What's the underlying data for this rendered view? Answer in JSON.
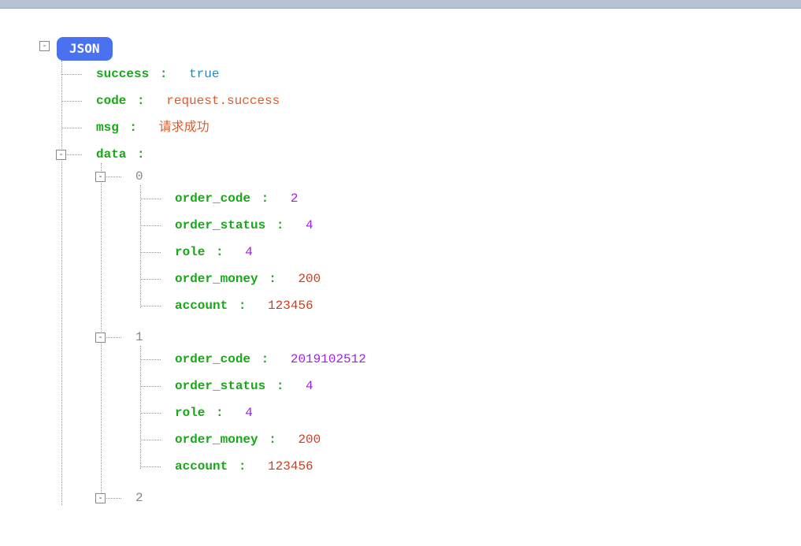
{
  "root_badge": "JSON",
  "toggle_minus": "-",
  "keys": {
    "success": "success",
    "code": "code",
    "msg": "msg",
    "data": "data",
    "order_code": "order_code",
    "order_status": "order_status",
    "role": "role",
    "order_money": "order_money",
    "account": "account"
  },
  "colon": ":",
  "values": {
    "success": "true",
    "code": "request.success",
    "msg": "请求成功"
  },
  "data_indices": {
    "i0": "0",
    "i1": "1",
    "i2": "2"
  },
  "data": [
    {
      "order_code": "2",
      "order_status": "4",
      "role": "4",
      "order_money": "200",
      "account": "123456"
    },
    {
      "order_code": "2019102512",
      "order_status": "4",
      "role": "4",
      "order_money": "200",
      "account": "123456"
    }
  ]
}
